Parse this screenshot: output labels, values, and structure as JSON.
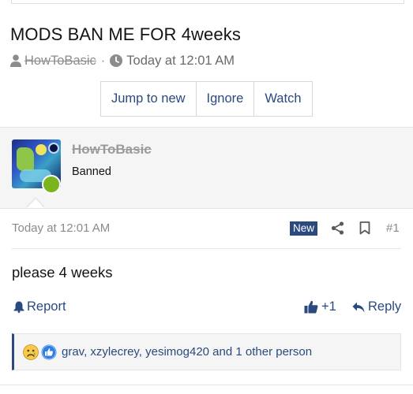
{
  "thread": {
    "title": "MODS BAN ME FOR 4weeks",
    "author": "HowToBasic",
    "separator": "·",
    "time": "Today at 12:01 AM",
    "actions": {
      "jump_to_new": "Jump to new",
      "ignore": "Ignore",
      "watch": "Watch"
    }
  },
  "post": {
    "author": "HowToBasic",
    "role": "Banned",
    "date": "Today at 12:01 AM",
    "badge": "New",
    "number": "#1",
    "body": "please 4 weeks",
    "report_label": "Report",
    "like_count": "+1",
    "reply_label": "Reply",
    "reactions_text": "grav, xzylecrey, yesimog420 and 1 other person"
  },
  "icons": {
    "meta_author": "user-icon",
    "meta_time": "clock-icon",
    "share": "share-icon",
    "bookmark": "bookmark-icon",
    "report": "bell-icon",
    "like": "thumbs-up-icon",
    "reply": "reply-icon",
    "reaction_1": "sad-face-icon",
    "reaction_2": "like-reaction-icon"
  },
  "colors": {
    "accent": "#2a4a7f",
    "online": "#7ab51d",
    "muted": "#8a8a8a"
  }
}
